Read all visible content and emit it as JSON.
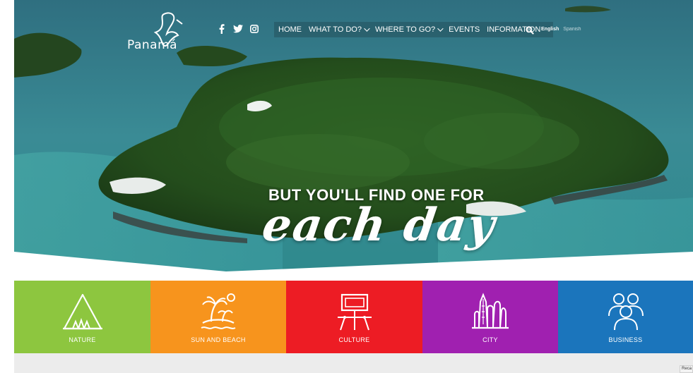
{
  "header": {
    "logo_text": "Panamá",
    "nav": [
      {
        "label": "HOME",
        "dropdown": false
      },
      {
        "label": "WHAT TO DO?",
        "dropdown": true
      },
      {
        "label": "WHERE TO GO?",
        "dropdown": true
      },
      {
        "label": "EVENTS",
        "dropdown": false
      },
      {
        "label": "INFORMATION",
        "dropdown": false
      }
    ],
    "social_icons": [
      "facebook-icon",
      "twitter-icon",
      "instagram-icon"
    ],
    "languages": {
      "active": "English",
      "inactive": "Spanish"
    }
  },
  "hero": {
    "tagline": "BUT YOU'LL FIND ONE FOR",
    "script": "each day"
  },
  "tiles": [
    {
      "label": "NATURE",
      "color": "#8dc63f",
      "icon": "mountain-icon"
    },
    {
      "label": "SUN AND BEACH",
      "color": "#f7941d",
      "icon": "island-palm-icon"
    },
    {
      "label": "CULTURE",
      "color": "#ed1c24",
      "icon": "painting-easel-icon"
    },
    {
      "label": "CITY",
      "color": "#a020b0",
      "icon": "skyline-icon"
    },
    {
      "label": "BUSINESS",
      "color": "#1b75bc",
      "icon": "people-group-icon"
    }
  ],
  "corner_badge": "Reca"
}
